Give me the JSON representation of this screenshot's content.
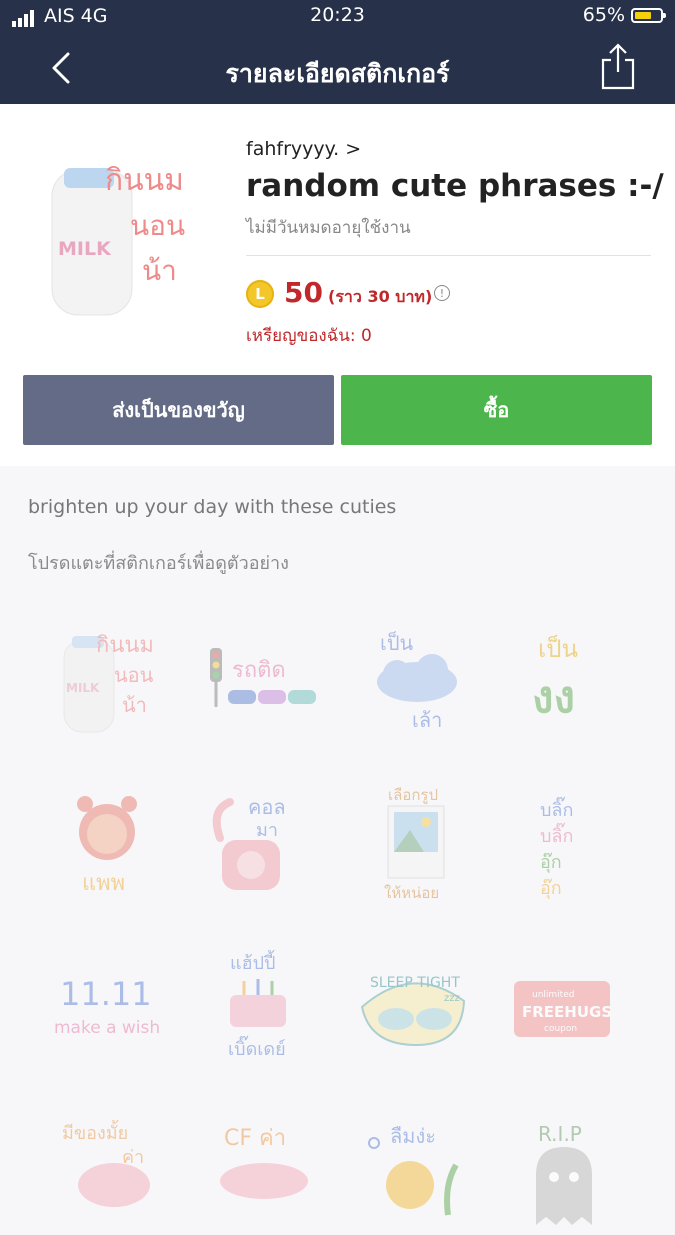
{
  "status_bar": {
    "carrier": "AIS",
    "network": "4G",
    "time": "20:23",
    "battery": "65%",
    "battery_level": 0.65
  },
  "nav": {
    "title": "รายละเอียดสติกเกอร์"
  },
  "sticker_pack": {
    "author": "fahfryyyy. >",
    "title": "random cute phrases :-/",
    "validity": "ไม่มีวันหมดอายุใช้งาน",
    "coin_letter": "L",
    "price": "50",
    "approx_price": "(ราว  30 บาท)",
    "my_coins": "เหรียญของฉัน: 0",
    "gift_label": "ส่งเป็นของขวัญ",
    "buy_label": "ซื้อ",
    "description": "brighten up your day with these cuties",
    "preview_hint": "โปรดแตะที่สติกเกอร์เพื่อดูตัวอย่าง",
    "thumb_text": [
      "กินนม",
      "นอน",
      "น้า"
    ],
    "thumb_milk": "MILK"
  },
  "stickers": [
    {
      "id": "milk",
      "text": [
        "กินนม",
        "นอน",
        "น้า"
      ]
    },
    {
      "id": "traffic",
      "text": [
        "รถติด"
      ]
    },
    {
      "id": "cloud",
      "text": [
        "เป็น",
        "เล้า"
      ]
    },
    {
      "id": "jj",
      "text": [
        "เป็น",
        "งง"
      ]
    },
    {
      "id": "alarm",
      "text": [
        "แพพ"
      ]
    },
    {
      "id": "phone",
      "text": [
        "คอล",
        "มา"
      ]
    },
    {
      "id": "photo",
      "text": [
        "เลือกรูป",
        "ให้หน่อย"
      ]
    },
    {
      "id": "blink",
      "text": [
        "บลิ๊ก",
        "บลิ๊ก",
        "อุ๊ก",
        "อุ๊ก"
      ]
    },
    {
      "id": "wish",
      "text": [
        "11.11",
        "make a wish"
      ]
    },
    {
      "id": "cake",
      "text": [
        "แฮ้ปปี้",
        "เบิ๊ดเดย์"
      ]
    },
    {
      "id": "sleep",
      "text": [
        "SLEEP TIGHT",
        "zzz"
      ]
    },
    {
      "id": "hugs",
      "text": [
        "unlimited",
        "FREEHUGS",
        "coupon"
      ]
    },
    {
      "id": "pig",
      "text": [
        "มีของมั้ย",
        "ค่า"
      ]
    },
    {
      "id": "cf",
      "text": [
        "CF ค่า"
      ]
    },
    {
      "id": "fish",
      "text": [
        "ลืมง่ะ"
      ]
    },
    {
      "id": "ghost",
      "text": [
        "R.I.P"
      ]
    }
  ]
}
